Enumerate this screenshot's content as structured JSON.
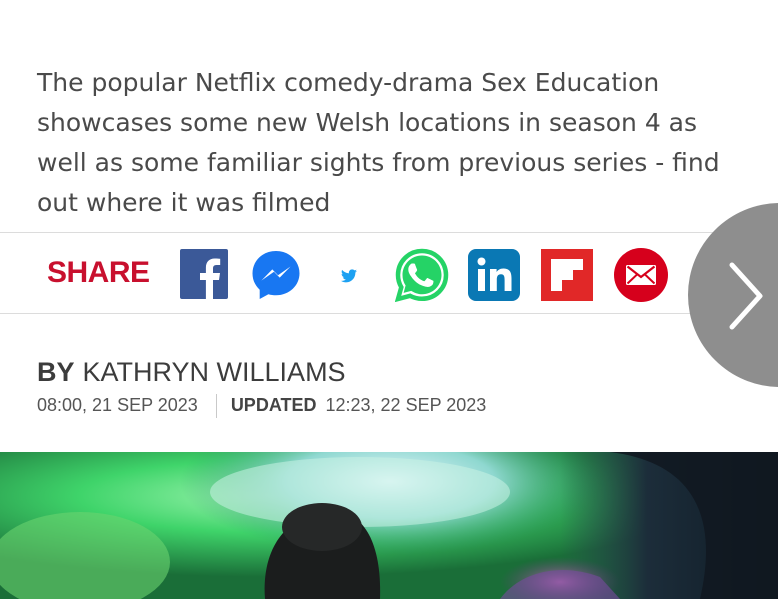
{
  "article": {
    "standfirst": "The popular Netflix comedy-drama Sex Education showcases some new Welsh locations in season 4 as well as some familiar sights from previous series - find out where it was filmed"
  },
  "share": {
    "label": "SHARE",
    "icons": [
      "facebook-icon",
      "messenger-icon",
      "twitter-icon",
      "whatsapp-icon",
      "linkedin-icon",
      "flipboard-icon",
      "email-icon"
    ],
    "colors": {
      "share_label": "#c8102e",
      "facebook": "#3b5998",
      "messenger": "#1877f2",
      "twitter": "#1da1f2",
      "whatsapp": "#25d366",
      "linkedin": "#0a78b4",
      "flipboard": "#e12828",
      "email": "#d6001c"
    }
  },
  "next": {
    "icon": "chevron-right-icon",
    "color": "#8e8e8e"
  },
  "byline": {
    "prefix": "BY",
    "author": "KATHRYN WILLIAMS",
    "published": "08:00, 21 SEP 2023",
    "updated_label": "UPDATED",
    "updated": "12:23, 22 SEP 2023"
  },
  "hero_image": {
    "type": "photo"
  }
}
